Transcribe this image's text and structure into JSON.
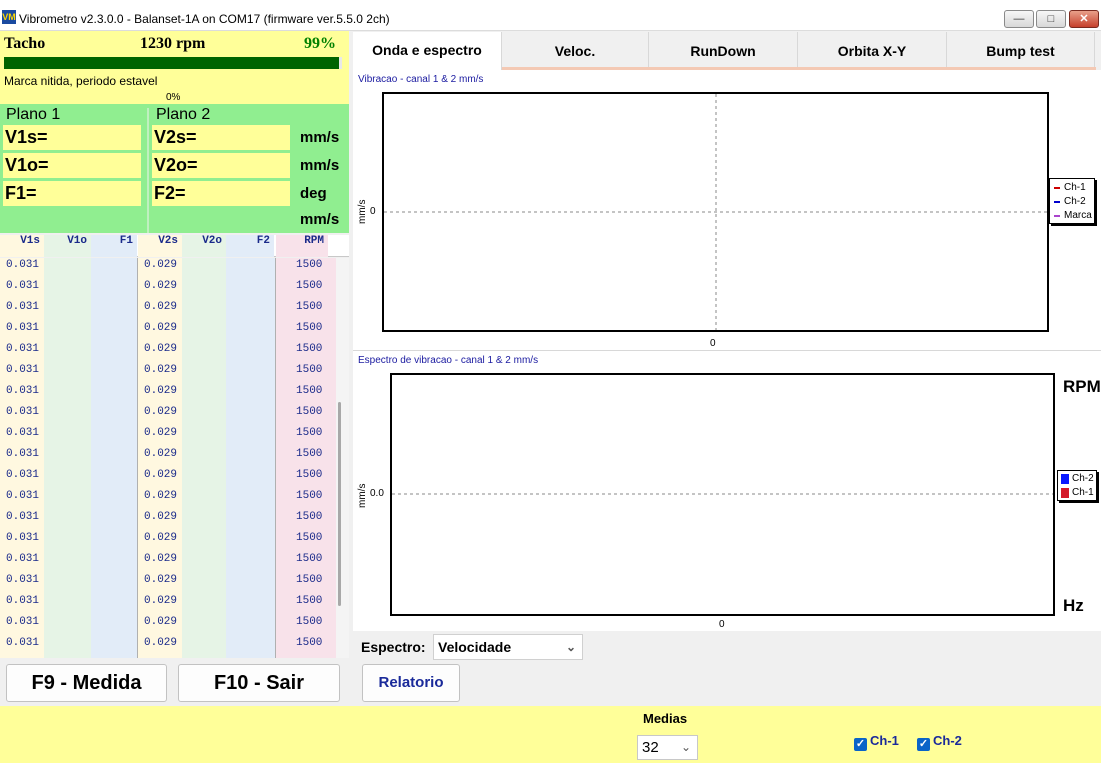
{
  "window": {
    "title": "Vibrometro v2.3.0.0 - Balanset-1A on COM17 (firmware ver.5.5.0 2ch)",
    "icon_text": "VM",
    "minimize_icon": "minimize-icon",
    "maximize_icon": "maximize-icon",
    "close_icon": "close-icon"
  },
  "tacho": {
    "label": "Tacho",
    "rpm": "1230 rpm",
    "percent": "99%",
    "progress": 0.99,
    "status": "Marca nitida, periodo estavel",
    "zero_label": "0%"
  },
  "planes": {
    "plane1_title": "Plano 1",
    "plane2_title": "Plano 2",
    "fields": [
      {
        "p1": "V1s=",
        "p2": "V2s=",
        "unit": "mm/s"
      },
      {
        "p1": "V1o=",
        "p2": "V2o=",
        "unit": "mm/s"
      },
      {
        "p1": "F1=",
        "p2": "F2=",
        "unit": "deg"
      }
    ],
    "extra_unit": "mm/s"
  },
  "table": {
    "headers": [
      "V1s",
      "V1o",
      "F1",
      "V2s",
      "V2o",
      "F2",
      "RPM"
    ],
    "rows": [
      [
        "0.031",
        "",
        "",
        "0.029",
        "",
        "",
        "1500"
      ],
      [
        "0.031",
        "",
        "",
        "0.029",
        "",
        "",
        "1500"
      ],
      [
        "0.031",
        "",
        "",
        "0.029",
        "",
        "",
        "1500"
      ],
      [
        "0.031",
        "",
        "",
        "0.029",
        "",
        "",
        "1500"
      ],
      [
        "0.031",
        "",
        "",
        "0.029",
        "",
        "",
        "1500"
      ],
      [
        "0.031",
        "",
        "",
        "0.029",
        "",
        "",
        "1500"
      ],
      [
        "0.031",
        "",
        "",
        "0.029",
        "",
        "",
        "1500"
      ],
      [
        "0.031",
        "",
        "",
        "0.029",
        "",
        "",
        "1500"
      ],
      [
        "0.031",
        "",
        "",
        "0.029",
        "",
        "",
        "1500"
      ],
      [
        "0.031",
        "",
        "",
        "0.029",
        "",
        "",
        "1500"
      ],
      [
        "0.031",
        "",
        "",
        "0.029",
        "",
        "",
        "1500"
      ],
      [
        "0.031",
        "",
        "",
        "0.029",
        "",
        "",
        "1500"
      ],
      [
        "0.031",
        "",
        "",
        "0.029",
        "",
        "",
        "1500"
      ],
      [
        "0.031",
        "",
        "",
        "0.029",
        "",
        "",
        "1500"
      ],
      [
        "0.031",
        "",
        "",
        "0.029",
        "",
        "",
        "1500"
      ],
      [
        "0.031",
        "",
        "",
        "0.029",
        "",
        "",
        "1500"
      ],
      [
        "0.031",
        "",
        "",
        "0.029",
        "",
        "",
        "1500"
      ],
      [
        "0.031",
        "",
        "",
        "0.029",
        "",
        "",
        "1500"
      ],
      [
        "0.031",
        "",
        "",
        "0.029",
        "",
        "",
        "1500"
      ]
    ]
  },
  "buttons": {
    "measure": "F9 - Medida",
    "exit": "F10 - Sair",
    "report": "Relatorio"
  },
  "tabs": [
    "Onda e espectro",
    "Veloc.",
    "RunDown",
    "Orbita X-Y",
    "Bump test"
  ],
  "active_tab": 0,
  "chart_data": [
    {
      "type": "line",
      "title": "Vibracao  - canal 1 & 2 mm/s",
      "ylabel": "mm/s",
      "x_tick": "0",
      "y_tick": "0",
      "legend": [
        {
          "name": "Ch-1",
          "color": "#cc0000"
        },
        {
          "name": "Ch-2",
          "color": "#0000cc"
        },
        {
          "name": "Marca",
          "color": "#aa44cc"
        }
      ],
      "series": []
    },
    {
      "type": "line",
      "title": "Espectro de vibracao  - canal 1 & 2 mm/s",
      "ylabel": "mm/s",
      "x_tick": "0",
      "y_tick": "0.0",
      "right_top_label": "RPM",
      "right_bottom_label": "Hz",
      "legend": [
        {
          "name": "Ch-2",
          "color": "#0a1aff"
        },
        {
          "name": "Ch-1",
          "color": "#d41a2a"
        }
      ],
      "series": []
    }
  ],
  "spectrum": {
    "label": "Espectro:",
    "value": "Velocidade"
  },
  "bottom": {
    "medias_label": "Medias",
    "medias_value": "32",
    "ch1_label": "Ch-1",
    "ch2_label": "Ch-2",
    "ch1_checked": true,
    "ch2_checked": true
  },
  "colors": {
    "yellow_panel": "#ffff99",
    "green_panel": "#90ee90",
    "progress": "#006400",
    "text_blue": "#1a2a8a"
  }
}
